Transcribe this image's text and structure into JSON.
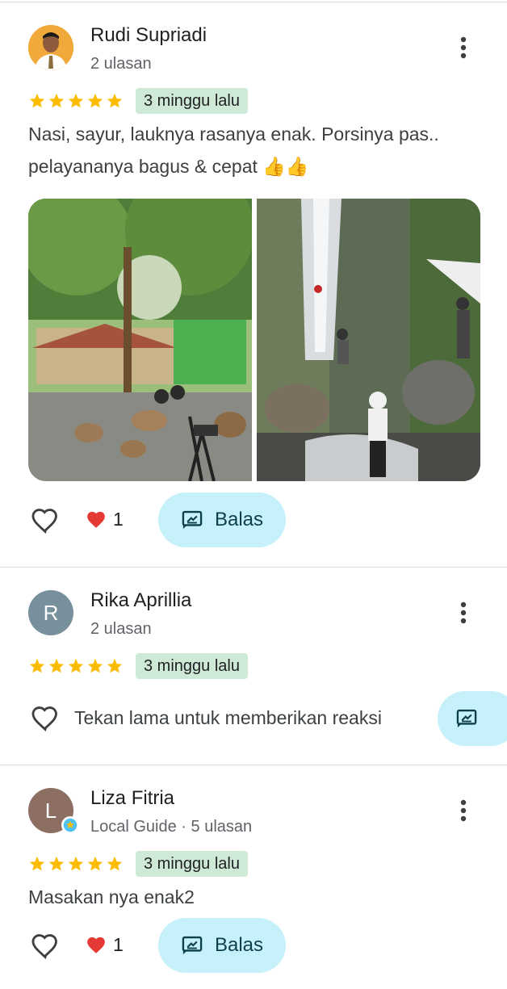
{
  "reviews": [
    {
      "author": "Rudi Supriadi",
      "meta": "2 ulasan",
      "time": "3 minggu lalu",
      "rating": 5,
      "text": "Nasi, sayur, lauknya rasanya enak. Porsinya pas.. pelayananya bagus & cepat 👍👍",
      "reaction_count": "1",
      "reply_label": "Balas",
      "photos": [
        "outdoor-camp-photo",
        "waterfall-rappelling-photo"
      ]
    },
    {
      "author": "Rika Aprillia",
      "avatar_letter": "R",
      "avatar_color": "#78909c",
      "meta": "2 ulasan",
      "time": "3 minggu lalu",
      "rating": 5,
      "hint": "Tekan lama untuk memberikan reaksi"
    },
    {
      "author": "Liza Fitria",
      "avatar_letter": "L",
      "avatar_color": "#8d6e63",
      "meta": "Local Guide · 5 ulasan",
      "time": "3 minggu lalu",
      "rating": 5,
      "text": "Masakan nya enak2",
      "reaction_count": "1",
      "reply_label": "Balas"
    }
  ],
  "colors": {
    "star": "#fbbc04",
    "badge": "#ceead6",
    "reply": "#c6f1fb",
    "heart_red": "#e53935"
  },
  "icons": [
    "more-vert-icon",
    "star-icon",
    "heart-outline-icon",
    "heart-filled-icon",
    "reply-icon"
  ]
}
